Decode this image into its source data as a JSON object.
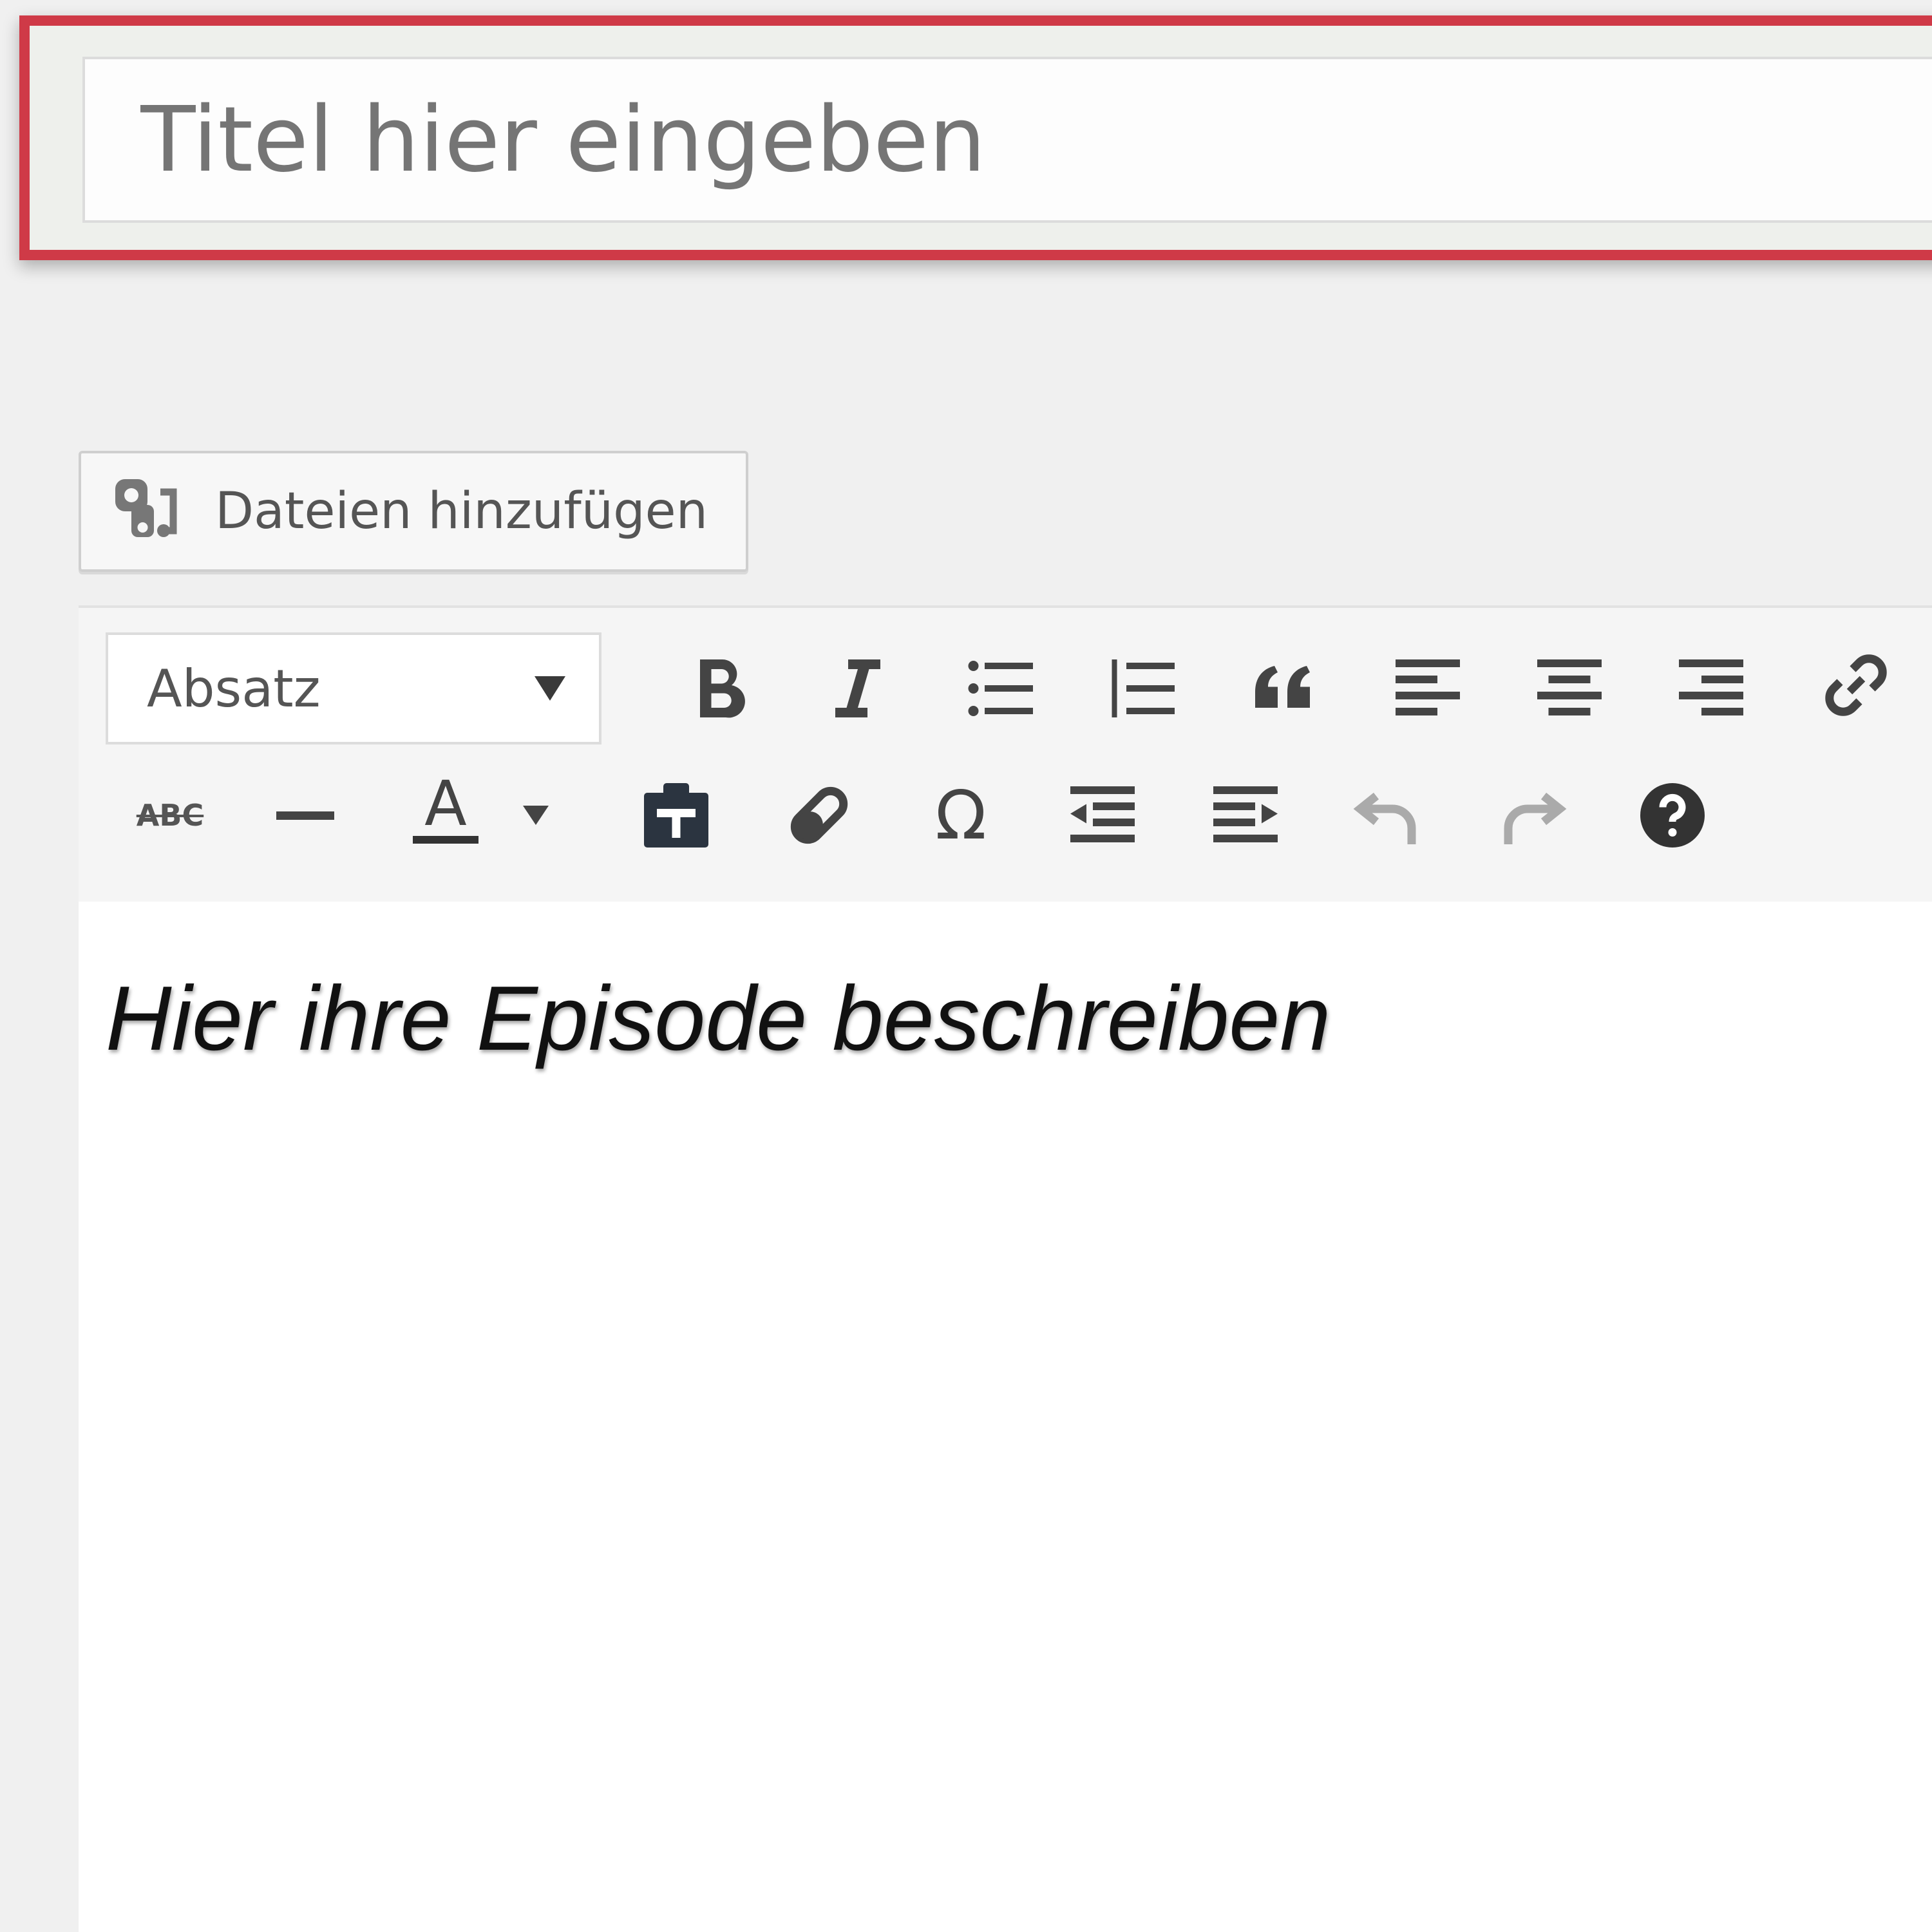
{
  "title_field": {
    "placeholder": "Titel hier eingeben",
    "highlight_color": "#cf3a47"
  },
  "media_button": {
    "label": "Dateien hinzufügen",
    "icon": "add-media-icon"
  },
  "toolbar": {
    "format_select": {
      "value": "Absatz"
    },
    "row1_icons": [
      "bold-icon",
      "italic-icon",
      "bulleted-list-icon",
      "numbered-list-icon",
      "blockquote-icon",
      "align-left-icon",
      "align-center-icon",
      "align-right-icon",
      "insert-link-icon"
    ],
    "row2_icons": [
      "strikethrough-icon",
      "horizontal-line-icon",
      "text-color-icon",
      "text-color-dropdown-icon",
      "paste-as-text-icon",
      "clear-formatting-icon",
      "special-character-icon",
      "outdent-icon",
      "indent-icon",
      "undo-icon",
      "redo-icon",
      "help-icon"
    ],
    "strike_glyph": "ABC",
    "text_color_glyph": "A",
    "omega_glyph": "Ω"
  },
  "editor": {
    "content": "Hier ihre Episode beschreiben"
  }
}
